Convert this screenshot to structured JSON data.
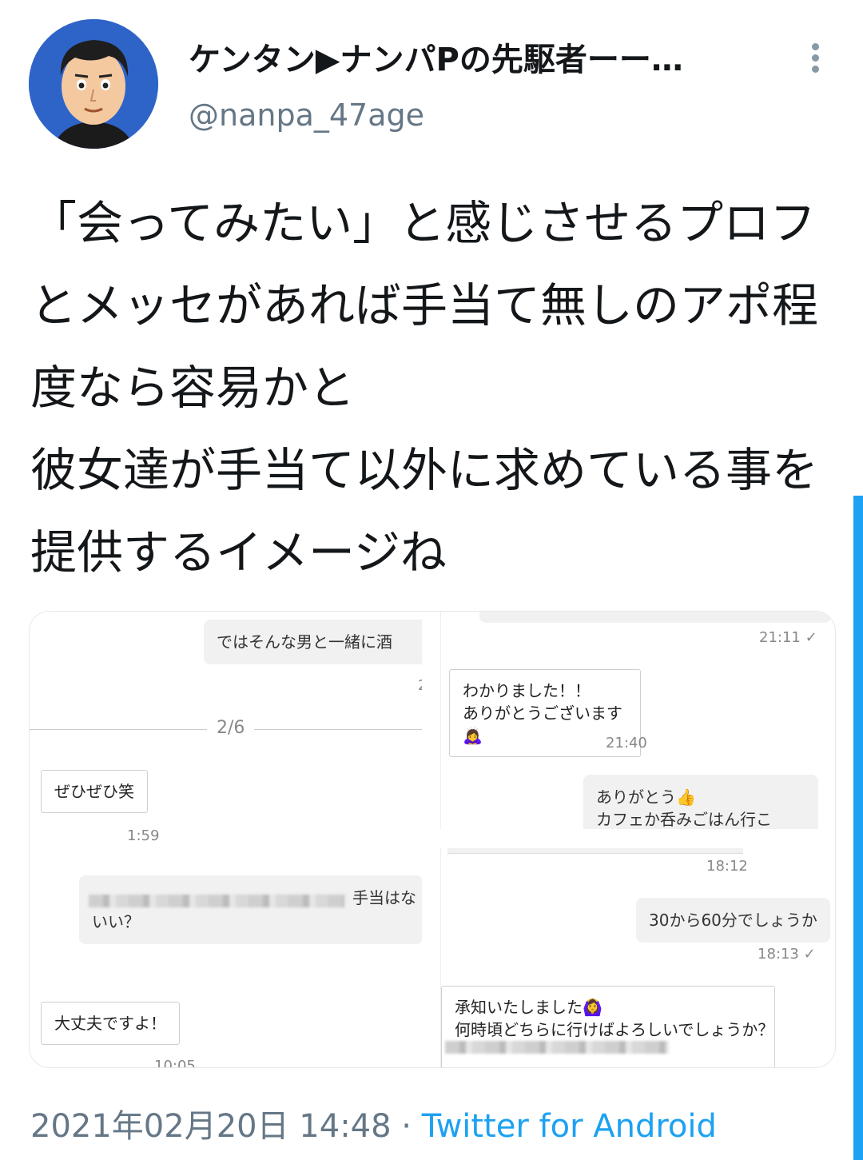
{
  "author": {
    "display_name": "ケンタン▶ナンパPの先駆者ーー…",
    "handle": "@nanpa_47age"
  },
  "tweet": {
    "text": "「会ってみたい」と感じさせるプロフとメッセがあれば手当て無しのアポ程度なら容易かと\n彼女達が手当て以外に求めている事を提供するイメージね"
  },
  "media": {
    "left": {
      "msg1": "ではそんな男と一緒に酒",
      "ts1": "2",
      "divider": "2/6",
      "msg2": "ぜひぜひ笑",
      "ts2": "1:59",
      "msg3_tail": "手当はな",
      "msg3_line2": "いい？",
      "msg4": "大丈夫ですよ！",
      "ts4": "10:05"
    },
    "right_top": {
      "ts1": "21:11 ✓",
      "msg1_line1": "わかりました！！",
      "msg1_line2": "ありがとうございます🙇‍♀️",
      "ts2": "21:40",
      "msg2_line1": "ありがとう👍",
      "msg2_line2": "カフェか呑みごはん行こ"
    },
    "right_bottom": {
      "ts1": "18:12",
      "msg1": "30から60分でしょうか",
      "ts2": "18:13 ✓",
      "msg2_line1": "承知いたしました🙆‍♀️",
      "msg2_line2": "何時頃どちらに行けばよろしいでしょうか？"
    }
  },
  "footer": {
    "datetime": "2021年02月20日 14:48",
    "separator": " · ",
    "source": "Twitter for Android"
  },
  "colors": {
    "accent": "#1da1f2",
    "secondary_text": "#657786"
  }
}
